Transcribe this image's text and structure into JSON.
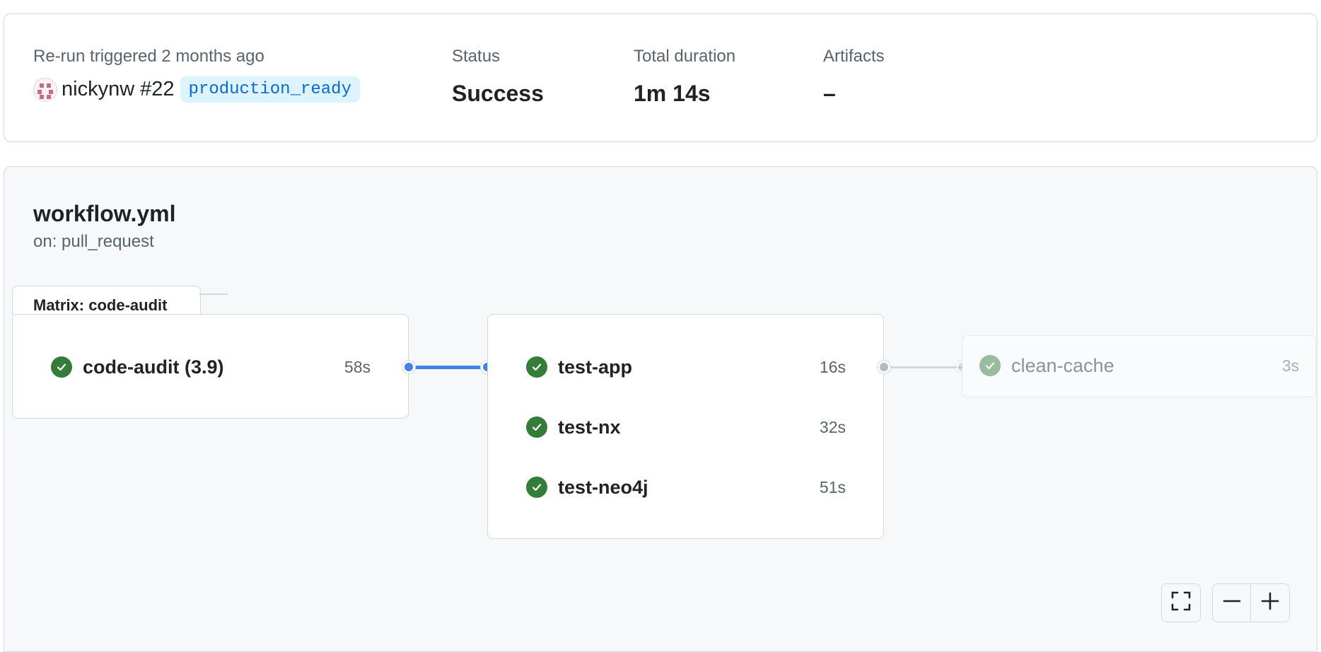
{
  "summary": {
    "trigger_label": "Re-run triggered 2 months ago",
    "actor": "nickynw",
    "run_number": "#22",
    "branch": "production_ready",
    "status_label": "Status",
    "status_value": "Success",
    "duration_label": "Total duration",
    "duration_value": "1m 14s",
    "artifacts_label": "Artifacts",
    "artifacts_value": "–"
  },
  "workflow": {
    "file": "workflow.yml",
    "trigger": "on: pull_request"
  },
  "matrix": {
    "tab_label": "Matrix: code-audit",
    "jobs": [
      {
        "name": "code-audit (3.9)",
        "duration": "58s",
        "status": "success"
      }
    ]
  },
  "test_group": {
    "jobs": [
      {
        "name": "test-app",
        "duration": "16s",
        "status": "success"
      },
      {
        "name": "test-nx",
        "duration": "32s",
        "status": "success"
      },
      {
        "name": "test-neo4j",
        "duration": "51s",
        "status": "success"
      }
    ]
  },
  "cleanup": {
    "jobs": [
      {
        "name": "clean-cache",
        "duration": "3s",
        "status": "success",
        "faded": true
      }
    ]
  },
  "icons": {
    "status": "check-circle-icon",
    "fullscreen": "fullscreen-icon",
    "zoom_out": "zoom-out-icon",
    "zoom_in": "zoom-in-icon"
  },
  "colors": {
    "success": "#347d39",
    "active_connector": "#4184e4",
    "inactive_connector": "#b3b9c0",
    "branch_text": "#0969da",
    "branch_bg": "#ddf4ff"
  }
}
